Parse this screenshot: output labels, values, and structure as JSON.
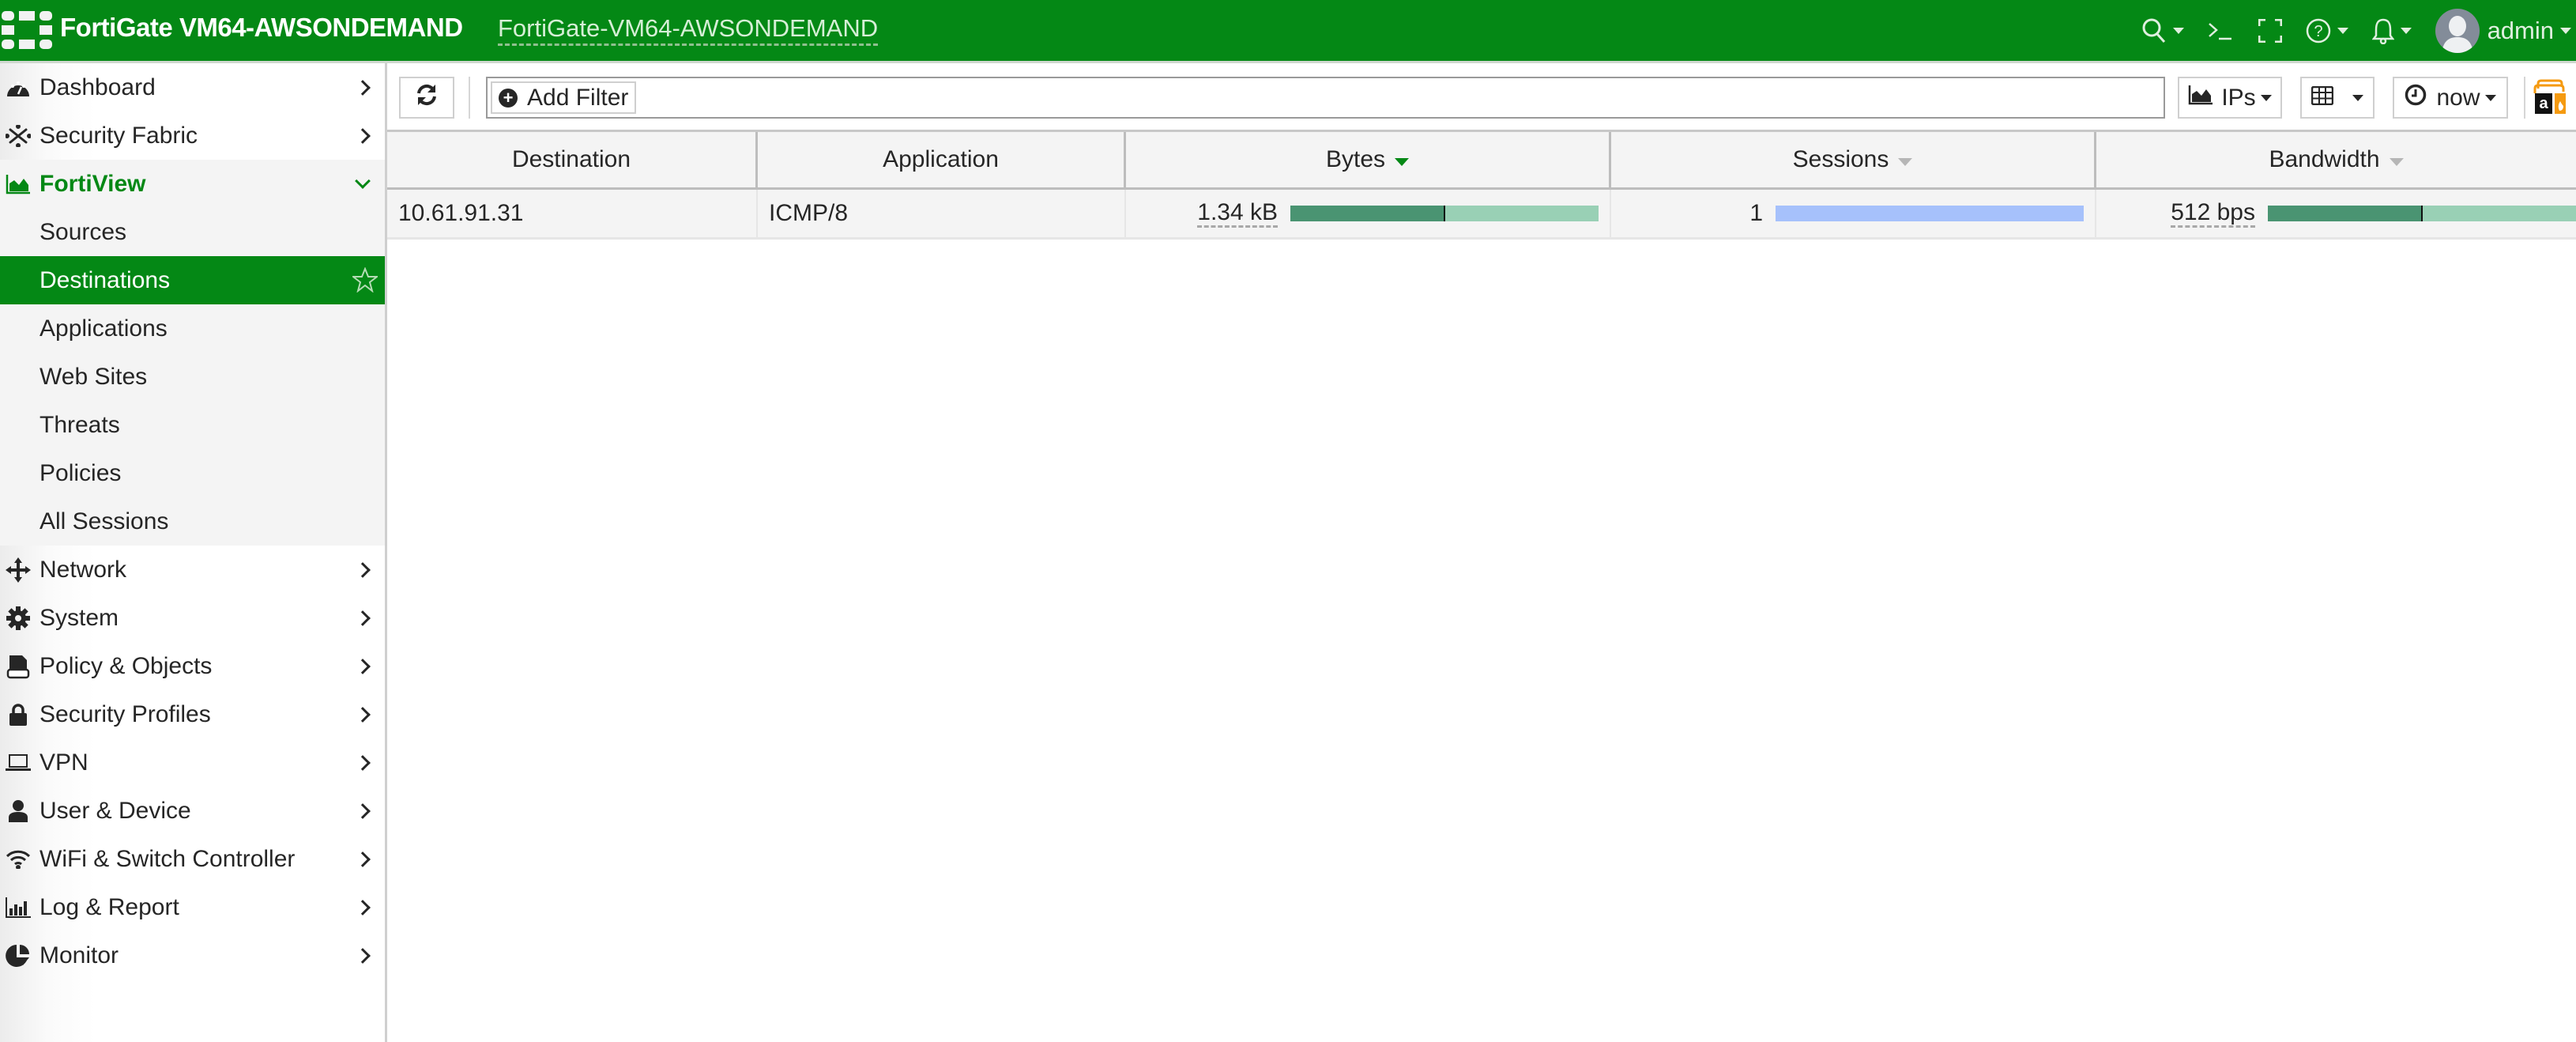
{
  "header": {
    "brand": "FortiGate VM64-AWSONDEMAND",
    "hostname": "FortiGate-VM64-AWSONDEMAND",
    "icons": [
      "search-icon",
      "cli-console-icon",
      "fullscreen-icon",
      "help-icon",
      "notifications-bell-icon",
      "user-avatar-icon"
    ],
    "user": "admin",
    "brand_color": "#048815"
  },
  "sidebar": {
    "items": [
      {
        "label": "Dashboard",
        "icon": "dashboard-icon"
      },
      {
        "label": "Security Fabric",
        "icon": "security-fabric-icon"
      },
      {
        "label": "FortiView",
        "icon": "area-chart-icon",
        "expanded": true,
        "children": [
          {
            "label": "Sources"
          },
          {
            "label": "Destinations",
            "active": true
          },
          {
            "label": "Applications"
          },
          {
            "label": "Web Sites"
          },
          {
            "label": "Threats"
          },
          {
            "label": "Policies"
          },
          {
            "label": "All Sessions"
          }
        ]
      },
      {
        "label": "Network",
        "icon": "arrows-move-icon"
      },
      {
        "label": "System",
        "icon": "gear-icon"
      },
      {
        "label": "Policy & Objects",
        "icon": "policy-document-icon"
      },
      {
        "label": "Security Profiles",
        "icon": "lock-icon"
      },
      {
        "label": "VPN",
        "icon": "laptop-icon"
      },
      {
        "label": "User & Device",
        "icon": "user-icon"
      },
      {
        "label": "WiFi & Switch Controller",
        "icon": "wifi-icon"
      },
      {
        "label": "Log & Report",
        "icon": "bar-chart-icon"
      },
      {
        "label": "Monitor",
        "icon": "pie-chart-icon"
      }
    ]
  },
  "toolbar": {
    "add_filter_label": "Add Filter",
    "view_mode_label": "IPs",
    "time_label": "now"
  },
  "table": {
    "columns": [
      {
        "label": "Destination",
        "sort": "none"
      },
      {
        "label": "Application",
        "sort": "none"
      },
      {
        "label": "Bytes",
        "sort": "desc-active"
      },
      {
        "label": "Sessions",
        "sort": "desc"
      },
      {
        "label": "Bandwidth",
        "sort": "desc"
      }
    ],
    "rows": [
      {
        "destination": "10.61.91.31",
        "application": "ICMP/8",
        "bytes": "1.34 kB",
        "bytes_split": {
          "sent_fraction": 0.5,
          "received_fraction": 0.5
        },
        "sessions": "1",
        "sessions_fraction": 1.0,
        "bandwidth": "512 bps",
        "bandwidth_split": {
          "sent_fraction": 0.5,
          "received_fraction": 0.5
        }
      }
    ],
    "colors": {
      "sent": "#4a9472",
      "received": "#99d0b5",
      "sessions": "#a6c1fb",
      "sort_active": "#048815"
    }
  }
}
